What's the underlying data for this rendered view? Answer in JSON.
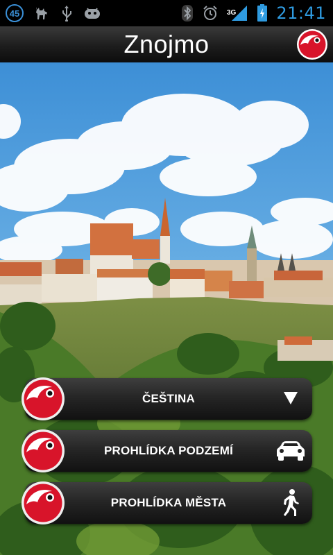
{
  "status_bar": {
    "notification_count": "45",
    "time": "21:41",
    "network_type": "3G",
    "icons": [
      "notification-count-badge",
      "deer-icon",
      "usb-icon",
      "android-debug-icon",
      "bluetooth-icon",
      "alarm-icon",
      "signal-icon",
      "battery-charging-icon"
    ]
  },
  "header": {
    "title": "Znojmo",
    "logo": "app-logo-icon"
  },
  "menu": {
    "items": [
      {
        "label": "ČEŠTINA",
        "icon": "dropdown-triangle-icon"
      },
      {
        "label": "PROHLÍDKA PODZEMÍ",
        "icon": "car-icon"
      },
      {
        "label": "PROHLÍDKA MĚSTA",
        "icon": "walking-person-icon"
      }
    ]
  },
  "colors": {
    "logo_red": "#d8142a",
    "clock_blue": "#2f9be0",
    "sky": "#4fa3e0"
  }
}
